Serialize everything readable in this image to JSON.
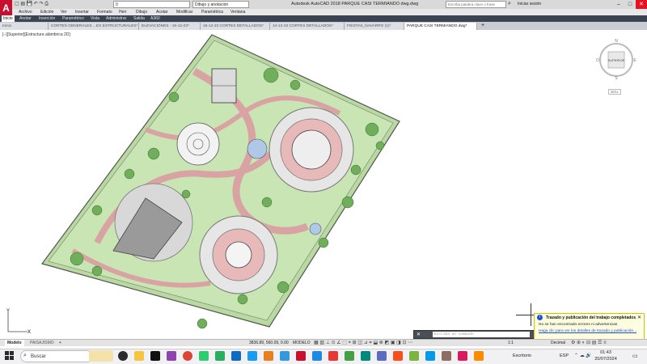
{
  "titlebar": {
    "workspace": "Dibujo y anotación",
    "layer_value": "0",
    "title": "Autodesk AutoCAD 2018    PARQUE CASI TERMIANDO dwg.dwg",
    "search_placeholder": "Escriba palabra clave o frase",
    "signin": "Iniciar sesión"
  },
  "menubar": [
    "Archivo",
    "Edición",
    "Ver",
    "Insertar",
    "Formato",
    "Herr",
    "Dibujo",
    "Acotar",
    "Modificar",
    "Paramétrica",
    "Ventana"
  ],
  "ribbon_tabs": [
    "Inicio",
    "Anotar",
    "Inserción",
    "Paramétrico",
    "Vista",
    "Administrar",
    "Salida",
    "A360"
  ],
  "doc_tabs": [
    "Inicio",
    "CORTES GENERALES ...ES ESTRUCTURALES*",
    "ELEVACIONES - 15-12-23*",
    "15-12-23 CORTES DETALLADOS*",
    "14-12-23 CORTES DETALLADOS*",
    "FIESTAS_NAVARRO (1)*",
    "PARQUE CASI TERMIANDO dwg*"
  ],
  "viewport_label": "[−][Superior][Estructura alámbrica 2D]",
  "viewcube": {
    "face": "SUPERIOR",
    "north": "N",
    "south": "S",
    "east": "E",
    "west": "O",
    "ucs": "SCU"
  },
  "notification": {
    "title": "Trazado y publicación del trabajo completados",
    "message": "No se han encontrado errores ni advertencias",
    "link": "Haga clic para ver los detalles de trazado y publicación..."
  },
  "command_placeholder": "Escriba un comando",
  "layout_tabs": [
    "Modelo",
    "PAISAJISMO"
  ],
  "statusbar": {
    "coords": "3836.89, 560.09, 0.00",
    "mode": "MODELO",
    "scale": "1:1",
    "units": "Decimal"
  },
  "taskbar": {
    "search": "Buscar",
    "desktop_label": "Escritorio",
    "lang": "ESP",
    "time": "01:43",
    "date": "20/07/2024"
  },
  "colors": {
    "accent": "#c8102e",
    "ribbon": "#3b4453",
    "grass": "#a9d18e",
    "path": "#e0b4b4"
  }
}
